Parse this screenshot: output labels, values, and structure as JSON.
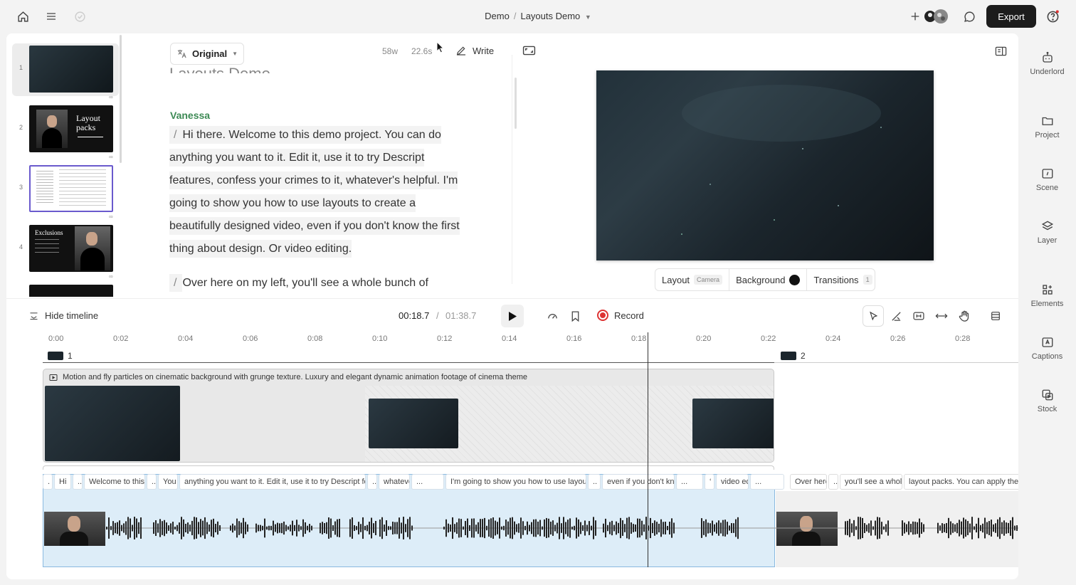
{
  "breadcrumb": {
    "project": "Demo",
    "separator": "/",
    "current": "Layouts Demo"
  },
  "export_label": "Export",
  "thumbnails": [
    {
      "num": "1",
      "kind": "dark"
    },
    {
      "num": "2",
      "kind": "layout",
      "text": "Layout packs"
    },
    {
      "num": "3",
      "kind": "doc"
    },
    {
      "num": "4",
      "kind": "exclusions",
      "text": "Exclusions"
    },
    {
      "num": "",
      "kind": "dark"
    }
  ],
  "script": {
    "language_button": "Original",
    "word_count": "58w",
    "duration": "22.6s",
    "write_label": "Write",
    "doc_title": "Layouts Demo",
    "speaker": "Vanessa",
    "paragraph1": "Hi there. Welcome to this demo project. You can do anything you want to it. Edit it, use it to try Descript features, confess your crimes to it, whatever's helpful. I'm going to show you how to use layouts to create a beautifully designed video, even if you don't know the first thing about design. Or video editing.",
    "paragraph2": "Over here on my left, you'll see a whole bunch of",
    "slash": "/"
  },
  "layout_bar": {
    "layout_label": "Layout",
    "layout_tag": "Camera",
    "background_label": "Background",
    "background_color": "#111111",
    "transitions_label": "Transitions",
    "transitions_count": "1"
  },
  "timeline": {
    "hide_label": "Hide timeline",
    "current_time": "00:18.7",
    "separator": "/",
    "total_time": "01:38.7",
    "record_label": "Record",
    "ruler": [
      "0:00",
      "0:02",
      "0:04",
      "0:06",
      "0:08",
      "0:10",
      "0:12",
      "0:14",
      "0:16",
      "0:18",
      "0:20",
      "0:22",
      "0:24",
      "0:26",
      "0:28"
    ],
    "scene1": "1",
    "scene2": "2",
    "media_title": "Motion and fly particles on cinematic background with grunge texture. Luxury and elegant dynamic animation footage of cinema theme",
    "words": [
      {
        "t": ".",
        "w": 6
      },
      {
        "t": "Hi",
        "w": 24
      },
      {
        "t": "..",
        "w": 10
      },
      {
        "t": "Welcome to this demo project.",
        "w": 86
      },
      {
        "t": "..",
        "w": 10
      },
      {
        "t": "You",
        "w": 28
      },
      {
        "t": "anything you want to it. Edit it, use it to try Descript features,",
        "w": 262
      },
      {
        "t": "..",
        "w": 10
      },
      {
        "t": "whatever's",
        "w": 44
      },
      {
        "t": "...",
        "w": 46
      },
      {
        "t": "I'm going to show you how to use layouts",
        "w": 198
      },
      {
        "t": "..",
        "w": 18
      },
      {
        "t": "even if you don't know",
        "w": 102
      },
      {
        "t": "...",
        "w": 38
      },
      {
        "t": "‘",
        "w": 6
      },
      {
        "t": "video editing.",
        "w": 46
      },
      {
        "t": "...",
        "w": 48
      },
      {
        "t": "Over here on",
        "w": 52
      },
      {
        "t": "..",
        "w": 10
      },
      {
        "t": "you'll see a whole",
        "w": 88
      },
      {
        "t": "layout packs. You can apply them",
        "w": 184
      }
    ]
  },
  "rail": [
    "Underlord",
    "Project",
    "Scene",
    "Layer",
    "Elements",
    "Captions",
    "Stock"
  ]
}
